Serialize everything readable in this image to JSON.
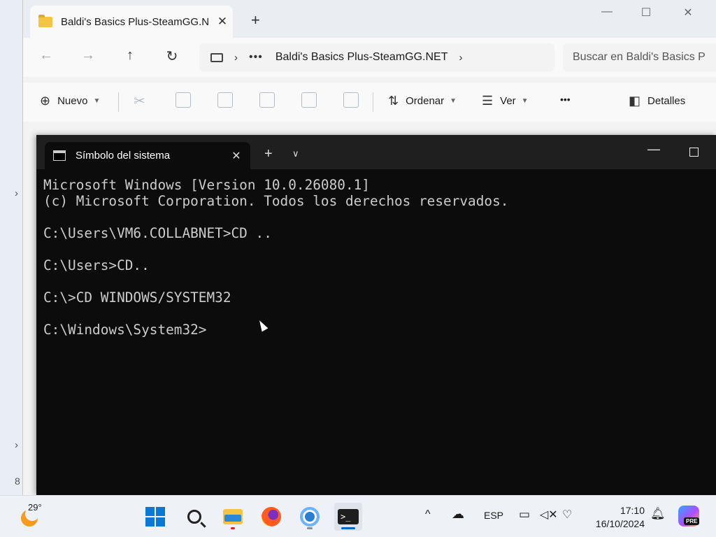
{
  "explorer": {
    "tab_title": "Baldi's Basics Plus-SteamGG.N",
    "new_tab": "+",
    "close": "✕",
    "address": {
      "more": "•••",
      "path": "Baldi's Basics Plus-SteamGG.NET"
    },
    "search_placeholder": "Buscar en Baldi's Basics P",
    "command_bar": {
      "new_label": "Nuevo",
      "sort_label": "Ordenar",
      "view_label": "Ver",
      "more_label": "•••",
      "details_label": "Detalles"
    },
    "sidebar_badge": "8"
  },
  "terminal": {
    "tab_title": "Símbolo del sistema",
    "console_lines": [
      "Microsoft Windows [Version 10.0.26080.1]",
      "(c) Microsoft Corporation. Todos los derechos reservados.",
      "",
      "C:\\Users\\VM6.COLLABNET>CD ..",
      "",
      "C:\\Users>CD..",
      "",
      "C:\\>CD WINDOWS/SYSTEM32",
      "",
      "C:\\Windows\\System32>"
    ]
  },
  "taskbar": {
    "temperature": "29°",
    "language": "ESP",
    "time": "17:10",
    "date": "16/10/2024",
    "copilot_badge": "PRE",
    "apps": [
      "start",
      "search",
      "file-explorer",
      "firefox",
      "chrome",
      "terminal"
    ]
  }
}
